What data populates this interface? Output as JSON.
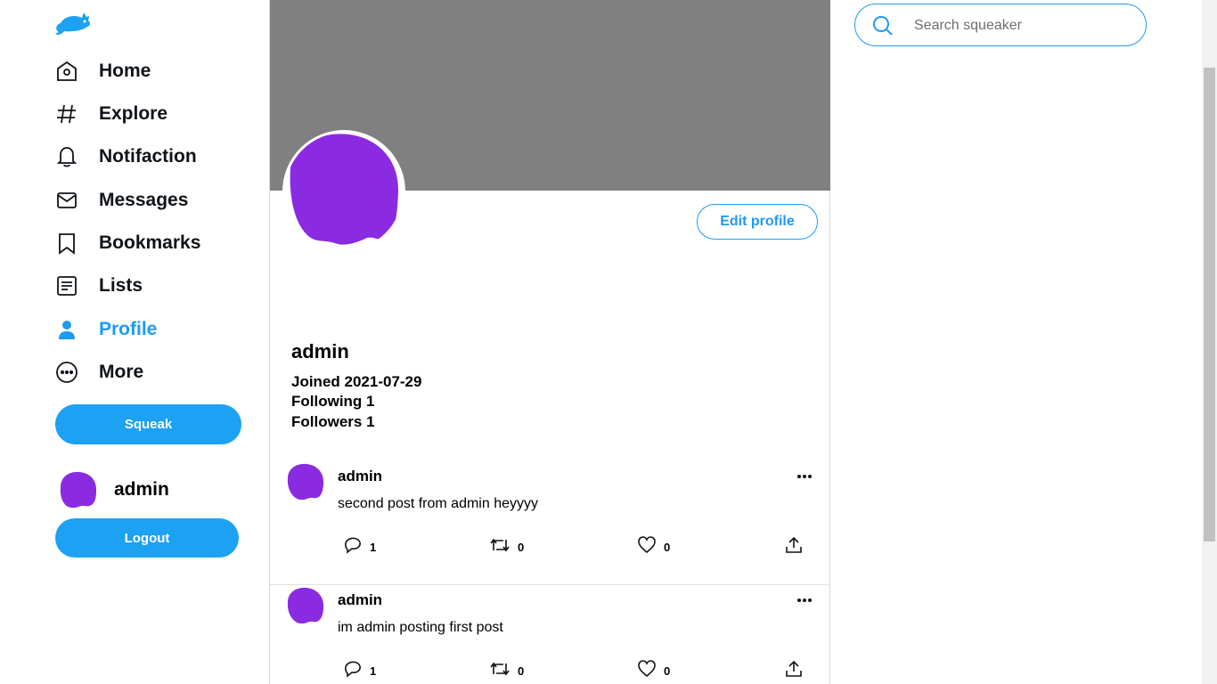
{
  "nav": {
    "items": [
      {
        "label": "Home",
        "icon": "home-icon"
      },
      {
        "label": "Explore",
        "icon": "hashtag-icon"
      },
      {
        "label": "Notifaction",
        "icon": "bell-icon"
      },
      {
        "label": "Messages",
        "icon": "envelope-icon"
      },
      {
        "label": "Bookmarks",
        "icon": "bookmark-icon"
      },
      {
        "label": "Lists",
        "icon": "list-icon"
      },
      {
        "label": "Profile",
        "icon": "person-icon",
        "active": true
      },
      {
        "label": "More",
        "icon": "more-circle-icon"
      }
    ],
    "squeak_label": "Squeak",
    "user_name": "admin",
    "logout_label": "Logout"
  },
  "profile": {
    "edit_label": "Edit profile",
    "name": "admin",
    "joined": "Joined 2021-07-29",
    "following": "Following 1",
    "followers": "Followers 1"
  },
  "tweets": [
    {
      "author": "admin",
      "text": "second post from admin heyyyy",
      "replies": "1",
      "retweets": "0",
      "likes": "0"
    },
    {
      "author": "admin",
      "text": "im admin posting first post",
      "replies": "1",
      "retweets": "0",
      "likes": "0"
    }
  ],
  "search": {
    "placeholder": "Search squeaker"
  },
  "colors": {
    "accent": "#1da1f2",
    "banner": "#808080",
    "avatar": "#8a2be2"
  }
}
